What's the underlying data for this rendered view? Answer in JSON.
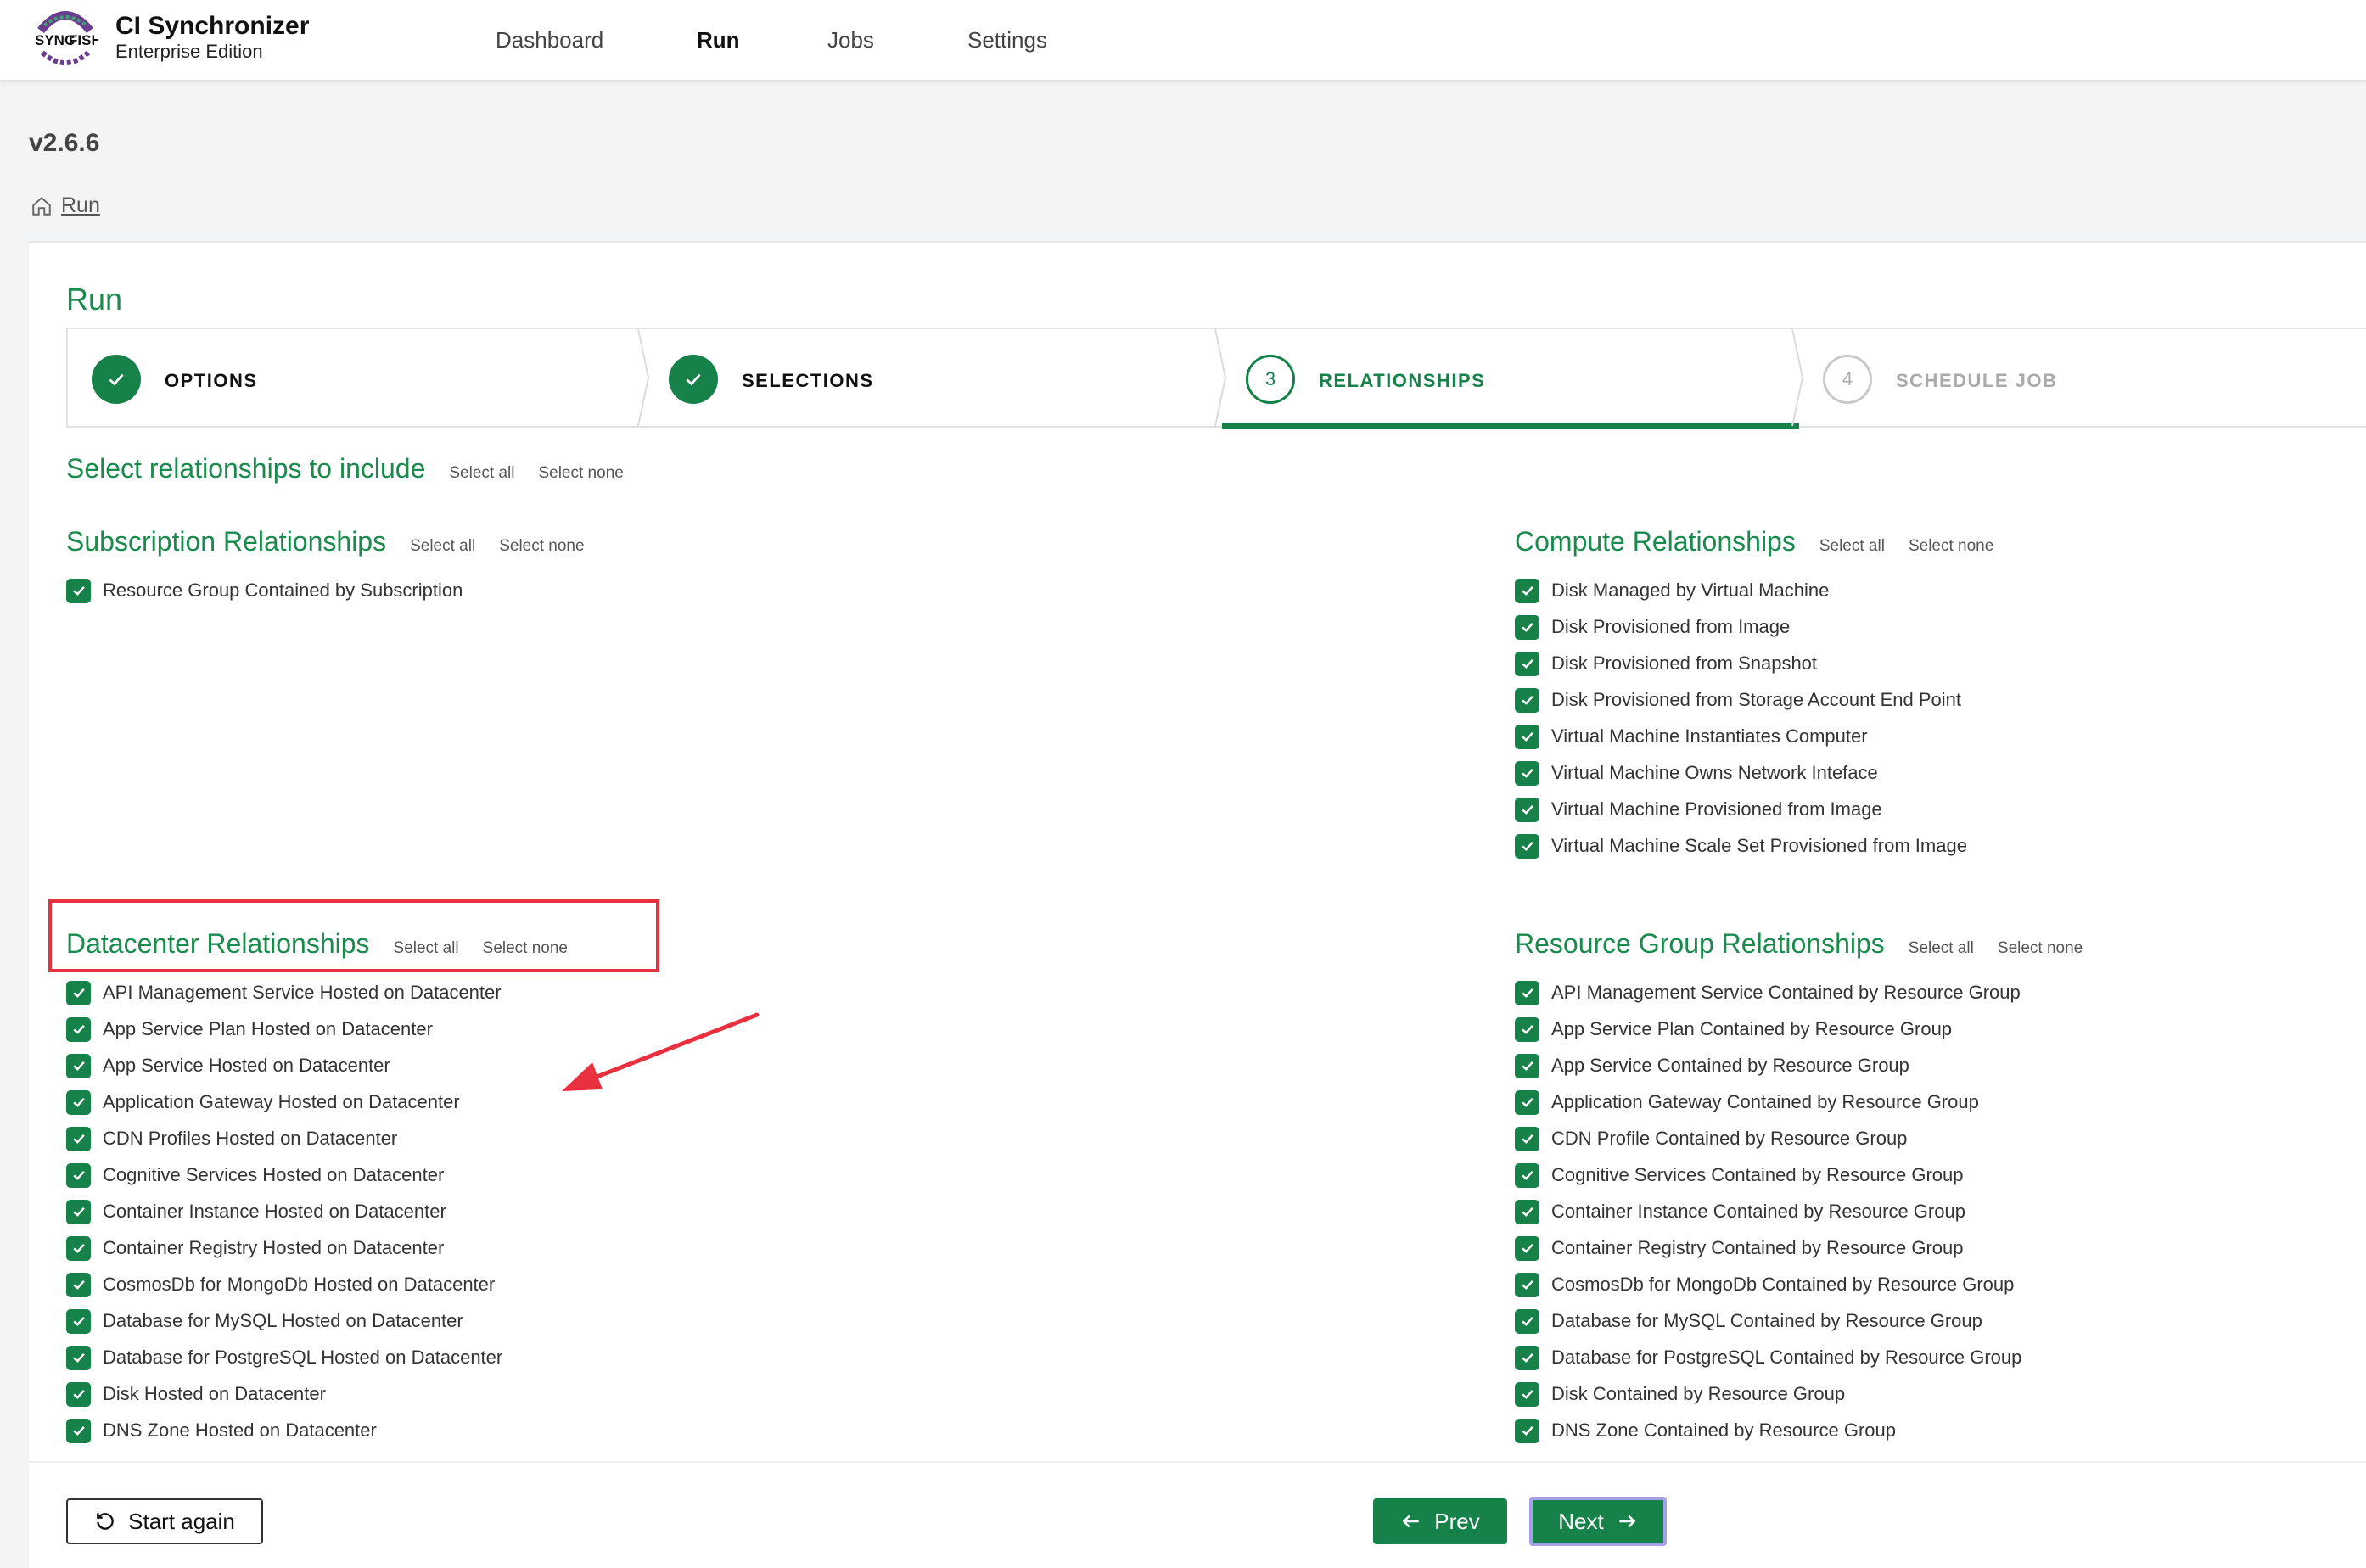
{
  "brand": {
    "logo_text_1": "SYNC",
    "logo_text_2": "FISH",
    "name": "CI Synchronizer",
    "edition": "Enterprise Edition"
  },
  "nav": [
    {
      "label": "Dashboard",
      "active": false
    },
    {
      "label": "Run",
      "active": true
    },
    {
      "label": "Jobs",
      "active": false
    },
    {
      "label": "Settings",
      "active": false
    }
  ],
  "version": "v2.6.6",
  "breadcrumb": {
    "label": "Run"
  },
  "page_title": "Run",
  "steps": [
    {
      "label": "OPTIONS",
      "state": "done",
      "number": "1"
    },
    {
      "label": "SELECTIONS",
      "state": "done",
      "number": "2"
    },
    {
      "label": "RELATIONSHIPS",
      "state": "current",
      "number": "3"
    },
    {
      "label": "SCHEDULE JOB",
      "state": "todo",
      "number": "4"
    }
  ],
  "select_all_label": "Select all",
  "select_none_label": "Select none",
  "main_heading": "Select relationships to include",
  "sections": {
    "subscription": {
      "title": "Subscription Relationships",
      "items": [
        "Resource Group Contained by Subscription"
      ]
    },
    "compute": {
      "title": "Compute Relationships",
      "items": [
        "Disk Managed by Virtual Machine",
        "Disk Provisioned from Image",
        "Disk Provisioned from Snapshot",
        "Disk Provisioned from Storage Account End Point",
        "Virtual Machine Instantiates Computer",
        "Virtual Machine Owns Network Inteface",
        "Virtual Machine Provisioned from Image",
        "Virtual Machine Scale Set Provisioned from Image"
      ]
    },
    "datacenter": {
      "title": "Datacenter Relationships",
      "items": [
        "API Management Service Hosted on Datacenter",
        "App Service Plan Hosted on Datacenter",
        "App Service Hosted on Datacenter",
        "Application Gateway Hosted on Datacenter",
        "CDN Profiles Hosted on Datacenter",
        "Cognitive Services Hosted on Datacenter",
        "Container Instance Hosted on Datacenter",
        "Container Registry Hosted on Datacenter",
        "CosmosDb for MongoDb Hosted on Datacenter",
        "Database for MySQL Hosted on Datacenter",
        "Database for PostgreSQL Hosted on Datacenter",
        "Disk Hosted on Datacenter",
        "DNS Zone Hosted on Datacenter"
      ]
    },
    "resource_group": {
      "title": "Resource Group Relationships",
      "items": [
        "API Management Service Contained by Resource Group",
        "App Service Plan Contained by Resource Group",
        "App Service Contained by Resource Group",
        "Application Gateway Contained by Resource Group",
        "CDN Profile Contained by Resource Group",
        "Cognitive Services Contained by Resource Group",
        "Container Instance Contained by Resource Group",
        "Container Registry Contained by Resource Group",
        "CosmosDb for MongoDb Contained by Resource Group",
        "Database for MySQL Contained by Resource Group",
        "Database for PostgreSQL Contained by Resource Group",
        "Disk Contained by Resource Group",
        "DNS Zone Contained by Resource Group"
      ]
    }
  },
  "buttons": {
    "start_again": "Start again",
    "prev": "Prev",
    "next": "Next"
  },
  "colors": {
    "accent": "#16824a",
    "title_green": "#1b8a4d",
    "annotation_red": "#e8303f",
    "focus_ring": "#a99ee8"
  }
}
